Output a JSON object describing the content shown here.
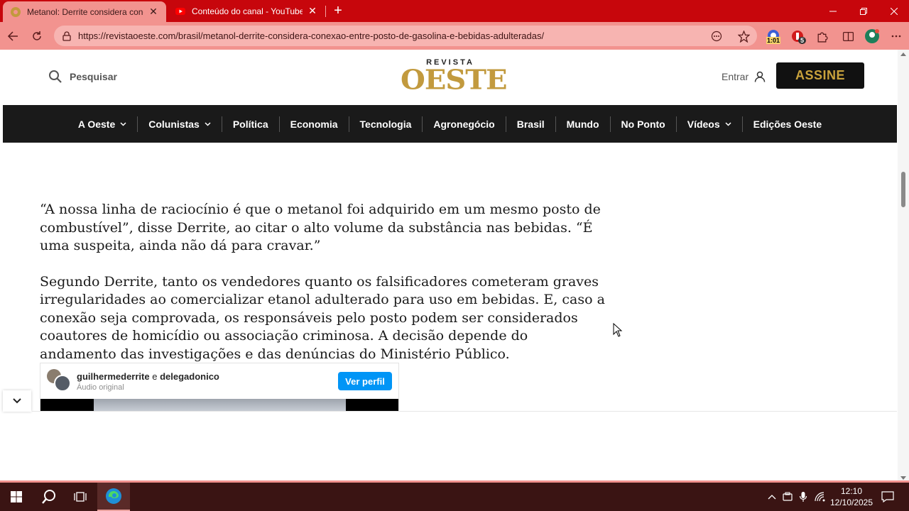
{
  "browser": {
    "tabs": [
      {
        "title": "Metanol: Derrite considera conex",
        "active": true
      },
      {
        "title": "Conteúdo do canal - YouTube Stu",
        "active": false
      }
    ],
    "url": "https://revistaoeste.com/brasil/metanol-derrite-considera-conexao-entre-posto-de-gasolina-e-bebidas-adulteradas/",
    "extension_badges": {
      "timer": "1:01",
      "count": "5"
    },
    "accent_color": "#c7060c"
  },
  "site": {
    "search_label": "Pesquisar",
    "logo_top": "REVISTA",
    "logo_main": "OESTE",
    "login_label": "Entrar",
    "subscribe_label": "ASSINE",
    "nav": [
      {
        "label": "A Oeste",
        "dropdown": true
      },
      {
        "label": "Colunistas",
        "dropdown": true
      },
      {
        "label": "Política",
        "dropdown": false
      },
      {
        "label": "Economia",
        "dropdown": false
      },
      {
        "label": "Tecnologia",
        "dropdown": false
      },
      {
        "label": "Agronegócio",
        "dropdown": false
      },
      {
        "label": "Brasil",
        "dropdown": false
      },
      {
        "label": "Mundo",
        "dropdown": false
      },
      {
        "label": "No Ponto",
        "dropdown": false
      },
      {
        "label": "Vídeos",
        "dropdown": true
      },
      {
        "label": "Edições Oeste",
        "dropdown": false
      }
    ]
  },
  "article": {
    "paragraphs": [
      "“A nossa linha de raciocínio é que o metanol foi adquirido em um mesmo posto de combustível”, disse Derrite, ao citar o alto volume da substância nas bebidas. “É uma suspeita, ainda não dá para cravar.”",
      "Segundo Derrite, tanto os vendedores quanto os falsificadores cometeram graves irregularidades ao comercializar etanol adulterado para uso em bebidas. E, caso a conexão seja comprovada, os responsáveis pelo posto podem ser considerados coautores de homicídio ou associação criminosa. A decisão depende do andamento das investigações e das denúncias do Ministério Público."
    ]
  },
  "instagram_embed": {
    "user1": "guilhermederrite",
    "joiner": "e",
    "user2": "delegadonico",
    "audio": "Áudio original",
    "button": "Ver perfil"
  },
  "taskbar": {
    "time": "12:10",
    "date": "12/10/2025"
  }
}
